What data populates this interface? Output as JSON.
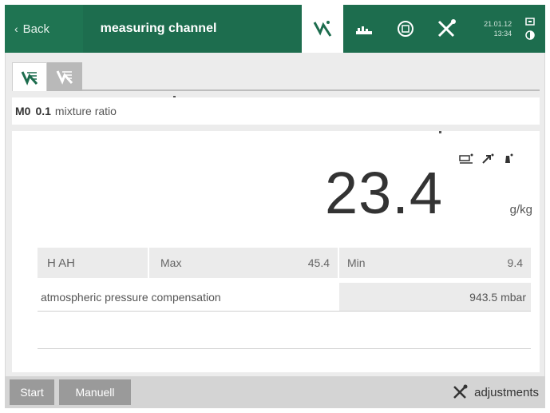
{
  "header": {
    "back_label": "Back",
    "title": "measuring channel",
    "date": "21.01.12",
    "time": "13:34"
  },
  "icons": {
    "measure": "measure-icon",
    "chart": "chart-icon",
    "save": "save-icon",
    "tools": "tools-icon",
    "network": "network-icon",
    "status": "status-icon"
  },
  "tabs": [
    {
      "name": "channel-tab",
      "active": true
    },
    {
      "name": "channel-tab-2",
      "active": false
    }
  ],
  "channel": {
    "id": "M0",
    "value": "0.1",
    "label": "mixture ratio"
  },
  "reading": {
    "value": "23.4",
    "unit": "g/kg"
  },
  "stats": {
    "name": "H AH",
    "max_label": "Max",
    "max_value": "45.4",
    "min_label": "Min",
    "min_value": "9.4"
  },
  "compensation": {
    "label": "atmospheric pressure compensation",
    "value": "943.5 mbar"
  },
  "bottom": {
    "start_label": "Start",
    "manual_label": "Manuell",
    "adjustments_label": "adjustments"
  },
  "colors": {
    "topbar": "#1d6d4e",
    "accent": "#1d6d4e",
    "button_grey": "#9a9a9a"
  }
}
